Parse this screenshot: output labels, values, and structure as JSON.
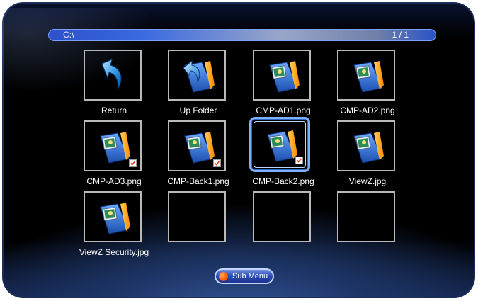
{
  "path_bar": {
    "path": "C:\\",
    "page": "1 / 1"
  },
  "grid": [
    {
      "label": "Return",
      "icon": "return-arrow-icon",
      "checked": false,
      "selected": false
    },
    {
      "label": "Up Folder",
      "icon": "up-folder-icon",
      "checked": false,
      "selected": false
    },
    {
      "label": "CMP-AD1.png",
      "icon": "image-folder-icon",
      "checked": false,
      "selected": false
    },
    {
      "label": "CMP-AD2.png",
      "icon": "image-folder-icon",
      "checked": false,
      "selected": false
    },
    {
      "label": "CMP-AD3.png",
      "icon": "image-folder-icon",
      "checked": true,
      "selected": false
    },
    {
      "label": "CMP-Back1.png",
      "icon": "image-folder-icon",
      "checked": true,
      "selected": false
    },
    {
      "label": "CMP-Back2.png",
      "icon": "image-folder-icon",
      "checked": true,
      "selected": true
    },
    {
      "label": "ViewZ.jpg",
      "icon": "image-folder-icon",
      "checked": false,
      "selected": false
    },
    {
      "label": "ViewZ Security.jpg",
      "icon": "image-folder-icon",
      "checked": false,
      "selected": false
    },
    {
      "label": "",
      "icon": "",
      "checked": false,
      "selected": false
    },
    {
      "label": "",
      "icon": "",
      "checked": false,
      "selected": false
    },
    {
      "label": "",
      "icon": "",
      "checked": false,
      "selected": false
    }
  ],
  "sub_menu": {
    "label": "Sub Menu",
    "icon": "orange-dot-icon"
  },
  "colors": {
    "accent": "#3a6be0",
    "selection": "#7fb0ff",
    "tile_border": "#b9b9b9",
    "check": "#e8401c"
  }
}
